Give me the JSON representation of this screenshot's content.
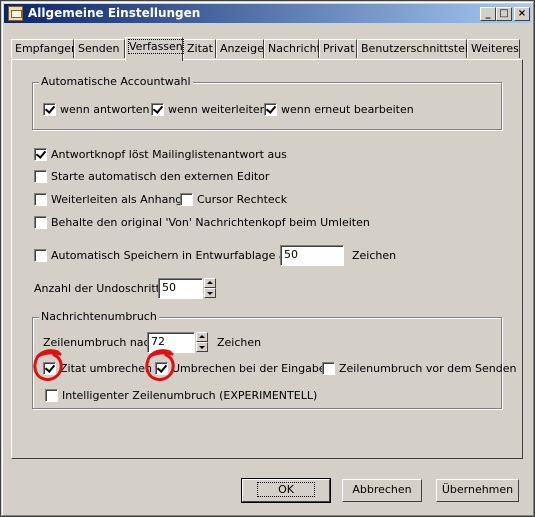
{
  "window": {
    "title": "Allgemeine Einstellungen"
  },
  "titlebar_buttons": {
    "minimize": "_",
    "maximize": "□",
    "close": "×"
  },
  "tabs": [
    {
      "label": "Empfangen",
      "active": false
    },
    {
      "label": "Senden",
      "active": false
    },
    {
      "label": "Verfassen",
      "active": true
    },
    {
      "label": "Zitat",
      "active": false
    },
    {
      "label": "Anzeige",
      "active": false
    },
    {
      "label": "Nachricht",
      "active": false
    },
    {
      "label": "Privat",
      "active": false
    },
    {
      "label": "Benutzerschnittstelle",
      "active": false
    },
    {
      "label": "Weiteres",
      "active": false
    }
  ],
  "account_group": {
    "title": "Automatische Accountwahl",
    "options": [
      {
        "label": "wenn antworten",
        "checked": true
      },
      {
        "label": "wenn weiterleiten",
        "checked": true
      },
      {
        "label": "wenn erneut bearbeiten",
        "checked": true
      }
    ]
  },
  "options": {
    "reply_button": {
      "label": "Antwortknopf löst Mailinglistenantwort aus",
      "checked": true
    },
    "external_editor": {
      "label": "Starte automatisch den externen Editor",
      "checked": false
    },
    "forward_attachment": {
      "label": "Weiterleiten als Anhang",
      "checked": false
    },
    "cursor_rect": {
      "label": "Cursor Rechteck",
      "checked": false
    },
    "keep_from": {
      "label": "Behalte den original 'Von' Nachrichtenkopf beim Umleiten",
      "checked": false
    },
    "autosave": {
      "label": "Automatisch Speichern in Entwurfablage alle",
      "checked": false,
      "value": "50",
      "unit": "Zeichen"
    }
  },
  "undo": {
    "label": "Anzahl der Undoschritte",
    "value": "50"
  },
  "wrap_group": {
    "title": "Nachrichtenumbruch",
    "line_wrap_label": "Zeilenumbruch nach",
    "line_wrap_value": "72",
    "line_wrap_unit": "Zeichen",
    "wrap_quote": {
      "label": "Zitat umbrechen",
      "checked": true
    },
    "wrap_on_input": {
      "label": "Umbrechen bei der Eingabe",
      "checked": true
    },
    "wrap_before_send": {
      "label": "Zeilenumbruch vor dem Senden",
      "checked": false
    },
    "smart_wrap": {
      "label": "Intelligenter Zeilenumbruch (EXPERIMENTELL)",
      "checked": false
    }
  },
  "buttons": {
    "ok": "OK",
    "cancel": "Abbrechen",
    "apply": "Übernehmen"
  },
  "colors": {
    "annotation": "#e01010",
    "titlebar_start": "#0a246a",
    "titlebar_end": "#a6caf0"
  }
}
